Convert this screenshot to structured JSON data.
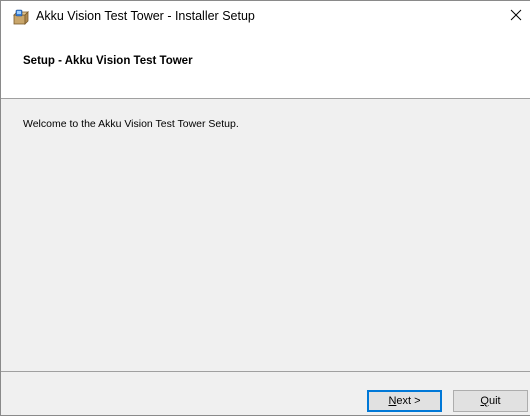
{
  "window": {
    "title": "Akku Vision Test Tower - Installer Setup",
    "icon": "installer-box-icon"
  },
  "header": {
    "title": "Setup - Akku Vision Test Tower"
  },
  "content": {
    "welcome_text": "Welcome to the Akku Vision Test Tower Setup."
  },
  "buttons": {
    "next": {
      "mnemonic": "N",
      "rest": "ext >"
    },
    "quit": {
      "mnemonic": "Q",
      "rest": "uit"
    }
  },
  "colors": {
    "focus_border": "#0078d7",
    "button_face": "#e1e1e1",
    "dialog_background": "#f0f0f0"
  }
}
